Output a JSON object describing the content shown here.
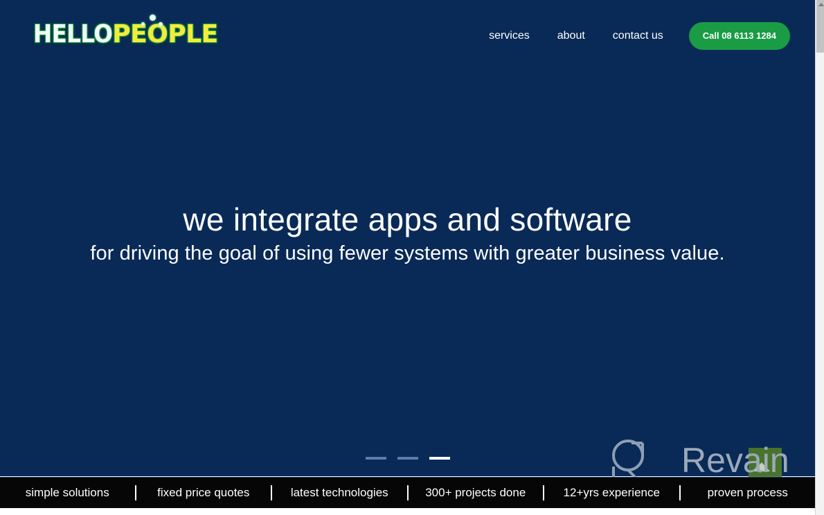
{
  "brand": {
    "logo_part1": "HELLO",
    "logo_part2": "PEOPLE",
    "logo_color_1": "#f2fff6",
    "logo_color_2": "#f2ec3d"
  },
  "nav": {
    "items": [
      {
        "label": "services"
      },
      {
        "label": "about"
      },
      {
        "label": "contact us"
      }
    ],
    "cta_label": "Call 08 6113 1284",
    "cta_color": "#1a9c45"
  },
  "hero": {
    "title": "we integrate apps and software",
    "subtitle": "for driving the goal of using fewer systems with greater business value.",
    "background_color": "#092a57"
  },
  "slider": {
    "dots": [
      {
        "active": false
      },
      {
        "active": false
      },
      {
        "active": true
      }
    ],
    "active_index": 2
  },
  "features": {
    "items": [
      {
        "label": "simple solutions"
      },
      {
        "label": "fixed price quotes"
      },
      {
        "label": "latest technologies"
      },
      {
        "label": "300+ projects done"
      },
      {
        "label": "12+yrs experience"
      },
      {
        "label": "proven process"
      }
    ],
    "background_color": "#060606"
  },
  "watermark": {
    "text": "Revain",
    "accent_color": "#4f7a2a"
  }
}
